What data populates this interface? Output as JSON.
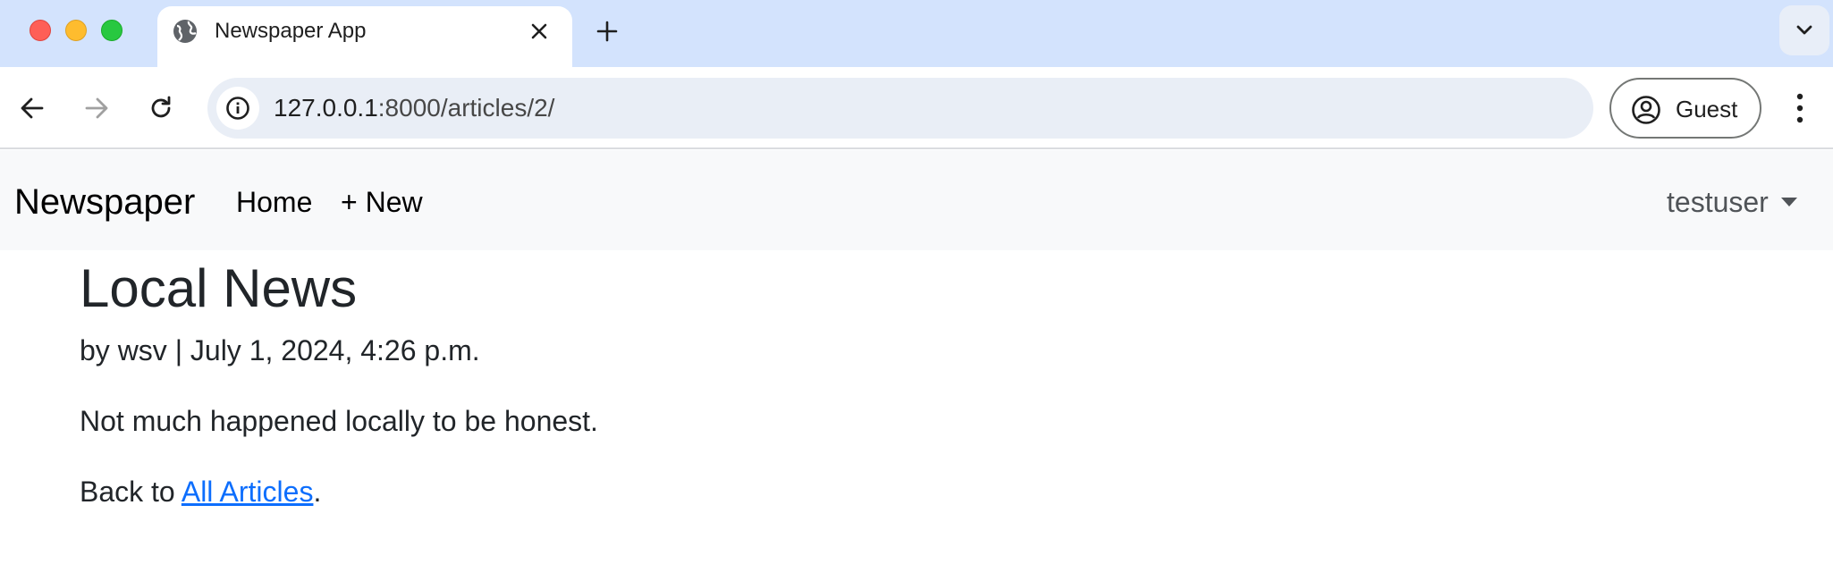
{
  "browser": {
    "tab_title": "Newspaper App",
    "url_host": "127.0.0.1",
    "url_path": ":8000/articles/2/",
    "profile_label": "Guest",
    "icons": {
      "favicon": "globe-icon",
      "close": "close-icon",
      "new_tab": "plus-icon",
      "tab_search": "chevron-down-icon",
      "back": "arrow-left-icon",
      "forward": "arrow-right-icon",
      "reload": "reload-icon",
      "site_info": "info-icon",
      "profile": "account-circle-icon",
      "menu": "more-vertical-icon"
    }
  },
  "navbar": {
    "brand": "Newspaper",
    "links": [
      "Home",
      "+ New"
    ],
    "user": "testuser"
  },
  "article": {
    "title": "Local News",
    "byline": "by wsv | July 1, 2024, 4:26 p.m.",
    "body": "Not much happened locally to be honest.",
    "back_prefix": "Back to ",
    "back_link": "All Articles",
    "back_suffix": "."
  },
  "colors": {
    "tabstrip": "#d3e3fd",
    "navbar_bg": "#f8f9fa",
    "link": "#0d6efd"
  }
}
